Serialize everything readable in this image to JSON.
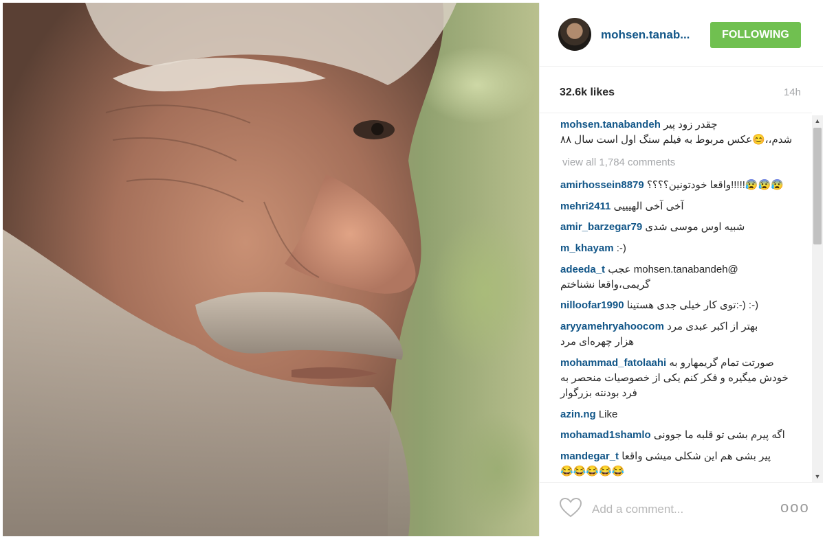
{
  "post": {
    "author": "mohsen.tanab...",
    "follow_label": "FOLLOWING",
    "likes": "32.6k likes",
    "time": "14h",
    "caption_user": "mohsen.tanabandeh",
    "caption_text_line1": "چقدر زود پیر",
    "caption_text_line2": "شدم،،😊عکس مربوط به فیلم سنگ اول است سال ۸۸",
    "view_all": "view all 1,784 comments",
    "add_comment_placeholder": "Add a comment...",
    "more_label": "ooo"
  },
  "comments": [
    {
      "user": "amirhossein8879",
      "text": "😰😰😰!!!!!واقعا خودتونین؟؟؟؟"
    },
    {
      "user": "mehri2411",
      "text": "آخی آخی الهیییی"
    },
    {
      "user": "amir_barzegar79",
      "text": "شبیه اوس موسی شدی"
    },
    {
      "user": "m_khayam",
      "text": ":-)"
    },
    {
      "user": "adeeda_t",
      "text": "@mohsen.tanabandeh عجب",
      "text2": "گریمی،واقعا نشناختم"
    },
    {
      "user": "nilloofar1990",
      "text": "(-: (-:توی کار خیلی جدی هستینا"
    },
    {
      "user": "aryyamehryahoocom",
      "text": "بهتر از اکبر عبدی مرد",
      "text2": "هزار چهره‌ای مرد"
    },
    {
      "user": "mohammad_fatolaahi",
      "text": "صورتت تمام گریمهارو به",
      "text2": "خودش میگیره و فکر کنم یکی از خصوصیات منحصر به",
      "text3": "فرد بودنته بزرگوار"
    },
    {
      "user": "azin.ng",
      "text": "Like"
    },
    {
      "user": "mohamad1shamlo",
      "text": "اگه پیرم بشی تو قلبه ما جوونی"
    },
    {
      "user": "mandegar_t",
      "text": "پیر بشی هم این شکلی میشی واقعا",
      "text2": "😂😂😂😂😂"
    }
  ],
  "colors": {
    "username_blue": "#125688",
    "follow_green": "#70c050",
    "muted_gray": "#a5a7aa"
  },
  "icons": {
    "heart": "heart-icon",
    "more": "more-options-icon",
    "avatar": "avatar"
  }
}
